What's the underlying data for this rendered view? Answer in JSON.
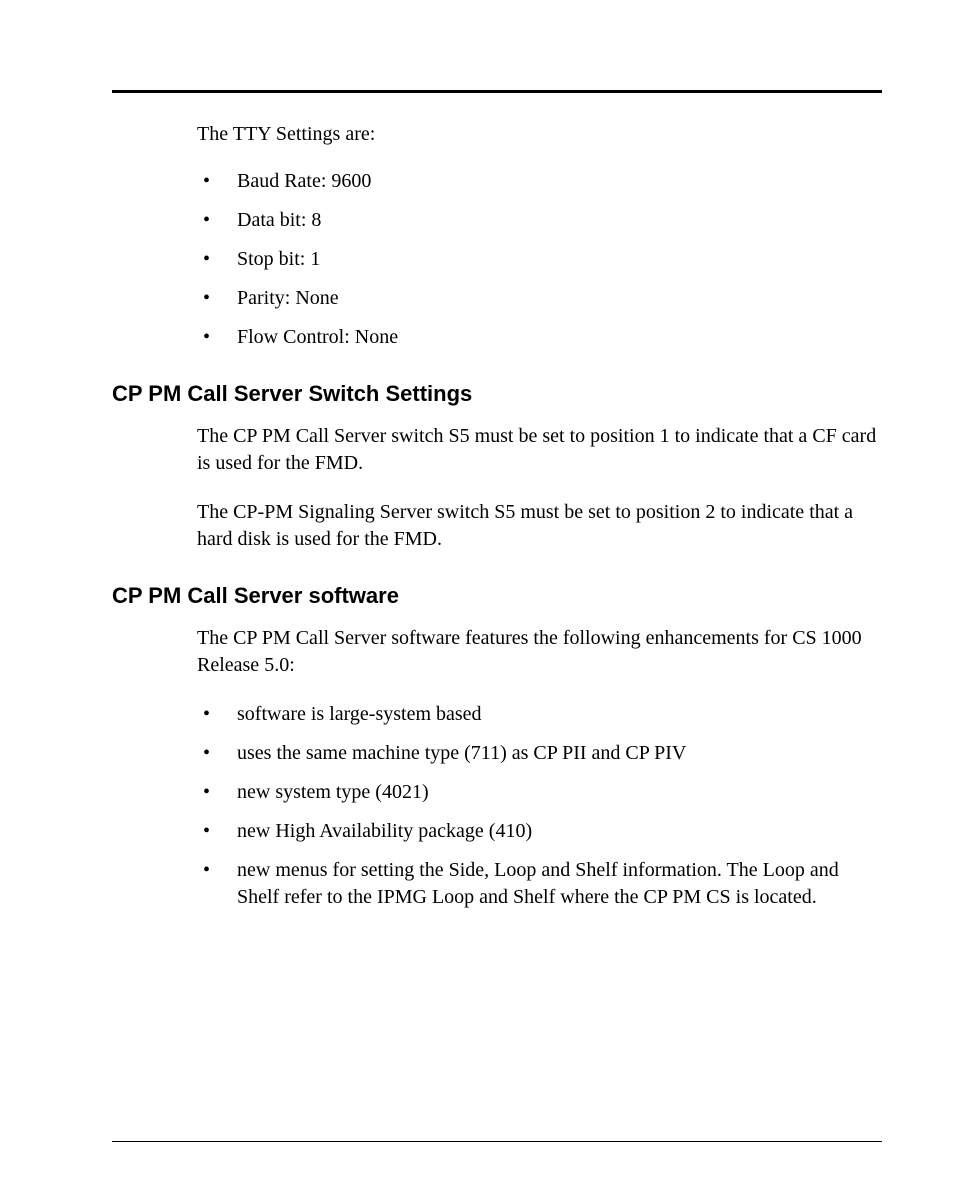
{
  "intro": {
    "lead": "The TTY Settings are:",
    "bullets": [
      "Baud Rate: 9600",
      "Data bit: 8",
      "Stop bit: 1",
      "Parity: None",
      "Flow Control: None"
    ]
  },
  "section1": {
    "heading": "CP PM Call Server Switch Settings",
    "para1": "The CP PM Call Server switch S5 must be set to position 1 to indicate that a CF card is used for the FMD.",
    "para2": "The CP-PM Signaling Server switch S5 must be set to position 2 to indicate that a hard disk is used for the FMD."
  },
  "section2": {
    "heading": "CP PM Call Server software",
    "lead": "The CP PM Call Server software features the following enhancements for CS 1000 Release 5.0:",
    "bullets": [
      "software is large-system based",
      "uses the same machine type (711) as CP PII and CP PIV",
      "new system type (4021)",
      "new High Availability package (410)",
      "new menus for setting the Side, Loop and Shelf information. The Loop and Shelf refer to the IPMG Loop and Shelf where the CP PM CS is located."
    ]
  }
}
